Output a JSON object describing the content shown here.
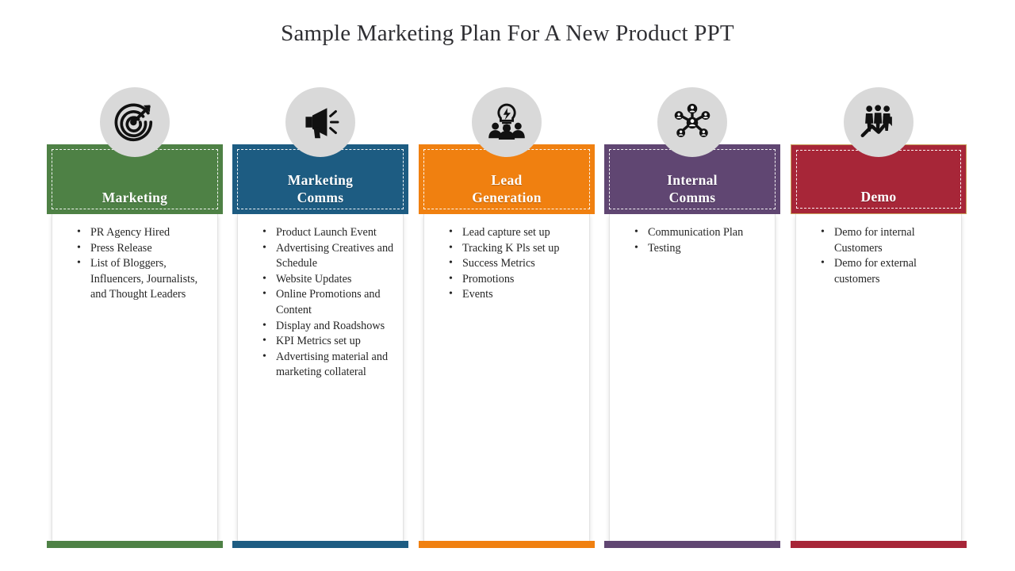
{
  "slide": {
    "title": "Sample Marketing Plan For A New Product PPT",
    "background": "#ffffff",
    "icon_circle_color": "#d9d9d9"
  },
  "columns": [
    {
      "id": "marketing",
      "title": "Marketing",
      "color": "#4E8145",
      "icon": "target-arrow-icon",
      "bullets": [
        "PR Agency Hired",
        "Press Release",
        "List of Bloggers, Influencers, Journalists, and Thought Leaders"
      ]
    },
    {
      "id": "marketing-comms",
      "title": "Marketing\nComms",
      "color": "#1D5C82",
      "icon": "megaphone-icon",
      "bullets": [
        "Product Launch Event",
        "Advertising Creatives and Schedule",
        "Website Updates",
        "Online Promotions and Content",
        "Display and Roadshows",
        "KPI Metrics set up",
        "Advertising material and marketing collateral"
      ]
    },
    {
      "id": "lead-generation",
      "title": "Lead\nGeneration",
      "color": "#F08010",
      "icon": "idea-team-icon",
      "bullets": [
        "Lead capture set up",
        "Tracking K Pls set up",
        "Success Metrics",
        "Promotions",
        "Events"
      ]
    },
    {
      "id": "internal-comms",
      "title": "Internal\nComms",
      "color": "#604672",
      "icon": "network-hub-icon",
      "bullets": [
        "Communication Plan",
        "Testing"
      ]
    },
    {
      "id": "demo",
      "title": "Demo",
      "color": "#A72638",
      "icon": "people-growth-icon",
      "bullets": [
        "Demo for internal Customers",
        "Demo for external customers"
      ]
    }
  ]
}
